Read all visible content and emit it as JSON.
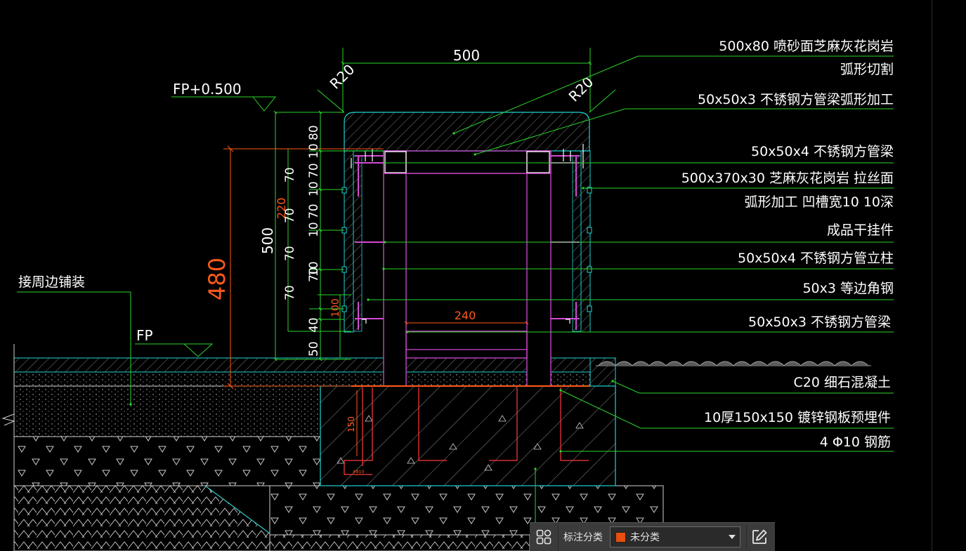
{
  "drawing": {
    "dim_width_top": "500",
    "radius_left": "R20",
    "radius_right": "R20",
    "level_top": "FP+0.500",
    "level_ground": "FP",
    "left_note": "接周边铺装",
    "dim_total_height": "480",
    "dim_bench_height": "500",
    "dim_inner_height": "220",
    "dim_inner_width": "240",
    "dim_footing": "150",
    "dim_bottom_100": "100",
    "dim_chain": [
      "10",
      "80",
      "70",
      "10",
      "70",
      "10",
      "70",
      "10",
      "70",
      "40",
      "50"
    ],
    "small_tag": "4Φ10",
    "annotations": [
      "500x80  喷砂面芝麻灰花岗岩",
      "弧形切割",
      "50x50x3 不锈钢方管梁弧形加工",
      "50x50x4 不锈钢方管梁",
      "500x370x30  芝麻灰花岗岩  拉丝面",
      "弧形加工  凹槽宽10  10深",
      "成品干挂件",
      "50x50x4 不锈钢方管立柱",
      "50x3 等边角钢",
      "50x50x3 不锈钢方管梁",
      "C20 细石混凝土",
      "10厚150x150 镀锌钢板预埋件",
      "4 Φ10 钢筋"
    ]
  },
  "toolbar": {
    "label": "标注分类",
    "selected": "未分类",
    "swatch_color": "#e84e0f"
  },
  "colors": {
    "background": "#000000",
    "dim_green": "#2bd62b",
    "cyan": "#1fd3d3",
    "magenta": "#d24ad2",
    "orange": "#ff5a1a",
    "white": "#ffffff"
  }
}
